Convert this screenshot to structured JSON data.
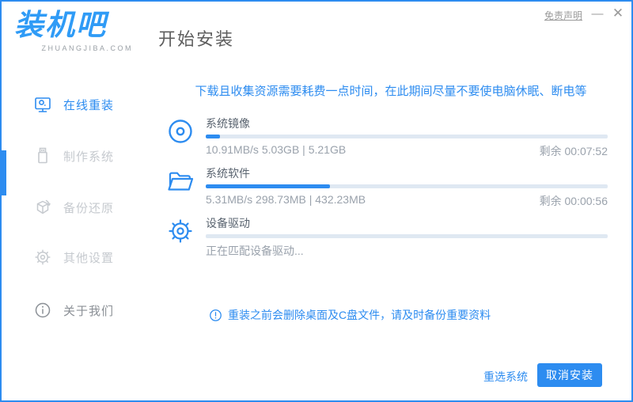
{
  "colors": {
    "accent": "#2d8cf0",
    "logo_blue": "#2f9bf6",
    "progress_track": "#dfe8f2",
    "label_dark": "#5a6470",
    "stat_gray": "#9aa2ac",
    "sidebar_inactive": "#c6cacf",
    "sidebar_about": "#8b9096"
  },
  "titlebar": {
    "disclaimer": "免责声明",
    "minimize": "—",
    "close": "✕"
  },
  "header": {
    "logo_text": "装机吧",
    "logo_sub": "ZHUANGJIBA.COM",
    "page_title": "开始安装"
  },
  "sidebar": {
    "items": [
      {
        "label": "在线重装",
        "icon": "monitor-icon",
        "state": "active"
      },
      {
        "label": "制作系统",
        "icon": "usb-icon",
        "state": "inactive"
      },
      {
        "label": "备份还原",
        "icon": "backup-icon",
        "state": "inactive"
      },
      {
        "label": "其他设置",
        "icon": "settings-icon",
        "state": "inactive"
      },
      {
        "label": "关于我们",
        "icon": "about-icon",
        "state": "about"
      }
    ]
  },
  "main": {
    "notice": "下载且收集资源需要耗费一点时间，在此期间尽量不要使电脑休眠、断电等",
    "tasks": [
      {
        "name": "系统镜像",
        "icon": "disc-icon",
        "progress_percent": 3.5,
        "stats": "10.91MB/s 5.03GB | 5.21GB",
        "remaining": "剩余 00:07:52"
      },
      {
        "name": "系统软件",
        "icon": "folder-open-icon",
        "progress_percent": 31,
        "stats": "5.31MB/s 298.73MB | 432.23MB",
        "remaining": "剩余 00:00:56"
      },
      {
        "name": "设备驱动",
        "icon": "gear-icon",
        "progress_percent": 0,
        "stats": "正在匹配设备驱动...",
        "remaining": ""
      }
    ],
    "note": "重装之前会删除桌面及C盘文件，请及时备份重要资料",
    "footer": {
      "reselect_label": "重选系统",
      "cancel_label": "取消安装"
    }
  }
}
